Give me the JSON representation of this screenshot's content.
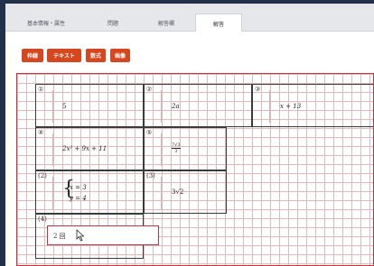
{
  "tabs": [
    {
      "label": "基本情報・属性",
      "active": false
    },
    {
      "label": "問題",
      "active": false
    },
    {
      "label": "解答欄",
      "active": false
    },
    {
      "label": "解答",
      "active": true
    }
  ],
  "toolbar": {
    "buttons": [
      "枠線",
      "テキスト",
      "数式",
      "画像"
    ],
    "button_color": "#d6461f"
  },
  "cells": [
    {
      "number": "①",
      "answer": "5"
    },
    {
      "number": "②",
      "answer": "2a"
    },
    {
      "number": "③",
      "answer": "x + 13"
    },
    {
      "number": "④",
      "answer": "2x² + 9x + 11"
    },
    {
      "number": "⑤",
      "answer_num": "7√3",
      "answer_den": "3"
    },
    {
      "number": "(2)",
      "system": [
        "x = 3",
        "y = 4"
      ]
    },
    {
      "number": "(3)",
      "answer": "3√2"
    },
    {
      "number": "(4)",
      "input_value": "2 回"
    }
  ],
  "colors": {
    "accent": "#c8323c",
    "grid": "#e7b8b8"
  }
}
